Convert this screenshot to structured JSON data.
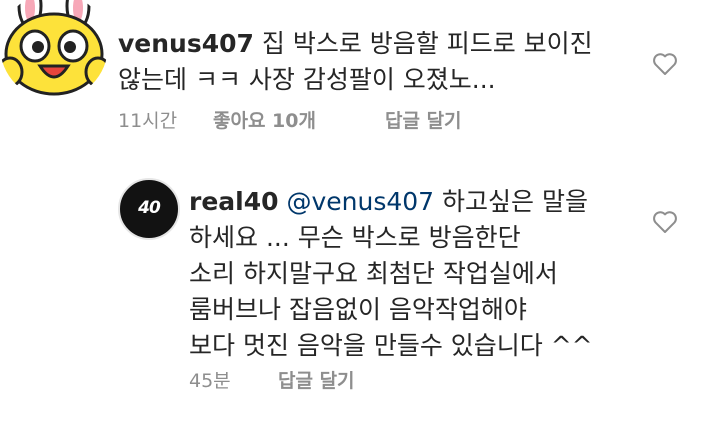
{
  "comments": [
    {
      "username": "venus407",
      "lines": [
        "집 박스로 방음할 피드로 보이진",
        "않는데 ㅋㅋ 사장 감성팔이 오졌노..."
      ],
      "time": "11시간",
      "likes": "좋아요 10개",
      "reply": "답글 달기",
      "avatar_icon": "yellow-bunny-cartoon-avatar",
      "like_icon": "heart-outline-icon"
    },
    {
      "username": "real40",
      "mention": "@venus407",
      "lines": [
        "하고싶은 말을",
        "하세요 ... 무슨 박스로 방음한단",
        "소리 하지말구요 최첨단 작업실에서",
        "룸버브나 잡음없이 음악작업해야",
        "보다 멋진 음악을 만들수 있습니다 ^^"
      ],
      "time": "45분",
      "reply": "답글 달기",
      "avatar_text": "40",
      "avatar_icon": "real40-logo-avatar",
      "like_icon": "heart-outline-icon"
    }
  ],
  "colors": {
    "text": "#262626",
    "meta": "#8e8e8e",
    "mention": "#00376b",
    "avatar_yellow": "#fde23a"
  }
}
